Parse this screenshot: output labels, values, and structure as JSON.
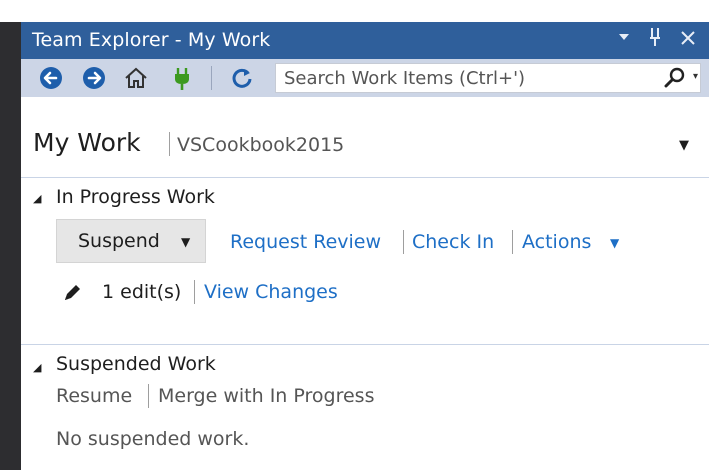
{
  "window": {
    "title": "Team Explorer - My Work",
    "controls": {
      "dropdown": "▾",
      "pin": "⊥",
      "close": "✕"
    }
  },
  "toolbar": {
    "back_icon": "back-arrow-icon",
    "forward_icon": "forward-arrow-icon",
    "home_icon": "home-icon",
    "connect_icon": "plug-icon",
    "refresh_icon": "refresh-icon",
    "search_placeholder": "Search Work Items (Ctrl+')",
    "search_value": ""
  },
  "header": {
    "title": "My Work",
    "project": "VSCookbook2015",
    "dropdown": "▼"
  },
  "in_progress": {
    "heading": "In Progress Work",
    "toggle": "◢",
    "suspend_label": "Suspend",
    "suspend_arrow": "▼",
    "request_review": "Request Review",
    "check_in": "Check In",
    "actions": "Actions",
    "actions_arrow": "▼",
    "edits": "1 edit(s)",
    "view_changes": "View Changes"
  },
  "suspended": {
    "heading": "Suspended Work",
    "toggle": "◢",
    "resume": "Resume",
    "merge": "Merge with In Progress",
    "empty_text": "No suspended work."
  },
  "colors": {
    "titlebar": "#2f5f9b",
    "toolbar": "#ccd5e6",
    "link": "#1e6fc6",
    "accent_button": "#1e5eab",
    "plug_green": "#3c9a1f"
  }
}
